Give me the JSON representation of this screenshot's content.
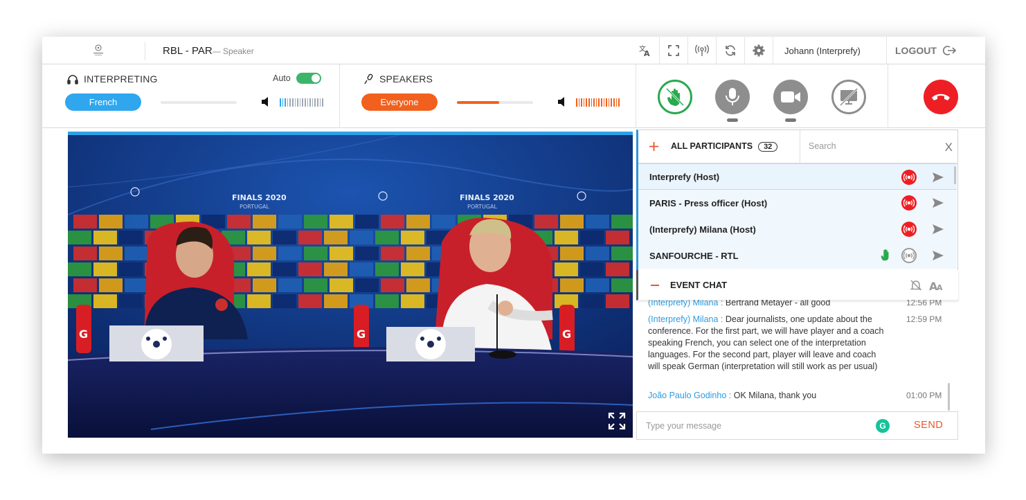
{
  "topbar": {
    "title": "RBL - PAR",
    "role": "— Speaker",
    "user": "Johann (Interprefy)",
    "logout": "LOGOUT",
    "icons": [
      "translate-icon",
      "fullscreen-icon",
      "broadcast-icon",
      "refresh-icon",
      "gear-icon"
    ]
  },
  "interpreting": {
    "label": "INTERPRETING",
    "auto_label": "Auto",
    "language": "French",
    "volume_percent": 0
  },
  "speakers": {
    "label": "SPEAKERS",
    "channel": "Everyone",
    "volume_percent": 55
  },
  "colors": {
    "blue": "#2fa6ee",
    "orange": "#f2601d",
    "green": "#2aa84f",
    "red": "#ee1f24",
    "gray": "#8e8e8e"
  },
  "participants": {
    "header": "ALL PARTICIPANTS",
    "count": "32",
    "search_placeholder": "Search",
    "close": "X",
    "list": [
      {
        "name": "Interprefy (Host)",
        "hand": false,
        "active": true
      },
      {
        "name": "PARIS - Press officer (Host)",
        "hand": false,
        "active": true
      },
      {
        "name": "(Interprefy) Milana (Host)",
        "hand": false,
        "active": true
      },
      {
        "name": "SANFOURCHE - RTL",
        "hand": true,
        "active": false
      }
    ]
  },
  "chat": {
    "header": "EVENT CHAT",
    "messages": [
      {
        "author": "(Interprefy) Milana :",
        "text": "Bertrand Metayer - all good",
        "time": "12:56 PM"
      },
      {
        "author": "(Interprefy) Milana :",
        "text": "Dear journalists, one update about the conference. For the first part, we will have player and a coach speaking French, you can select one of the interpretation languages. For the second part, player will leave and coach will speak German (interpretation will still work as per usual)",
        "time": "12:59 PM"
      },
      {
        "author": "João Paulo Godinho :",
        "text": "OK Milana, thank you",
        "time": "01:00 PM"
      }
    ],
    "input_placeholder": "Type your message",
    "send_label": "SEND",
    "grammarly": "G"
  },
  "video": {
    "backdrop_text": "FINALS 2020",
    "backdrop_sub": "PORTUGAL"
  }
}
